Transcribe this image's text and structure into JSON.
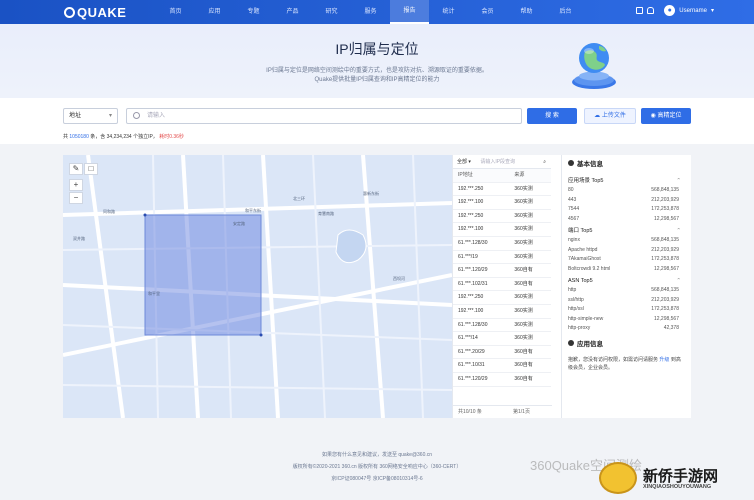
{
  "header": {
    "logo": "QUAKE",
    "nav": [
      "首页",
      "应用",
      "专题",
      "产品",
      "研究",
      "服务",
      "报告",
      "统计",
      "会员",
      "帮助",
      "后台"
    ],
    "active_nav": "报告",
    "username": "Username"
  },
  "hero": {
    "title": "IP归属与定位",
    "line1": "IP归属与定位是网络空间测绘中的重要方式，也是攻防对抗、溯源取证的重要依据。",
    "line2": "Quake提供批量IP归属查询和IP高精定位的能力"
  },
  "search": {
    "select_value": "地址",
    "placeholder": "请输入",
    "search_btn": "搜 索",
    "upload_btn": "上传文件",
    "locate_btn": "高精定位",
    "stats_prefix": "共",
    "stats_count": "1050180",
    "stats_mid": "条，含 34,234,234 个独立IP，",
    "stats_red": "耗时0.36秒"
  },
  "map": {
    "labels": [
      "同和路",
      "北三环",
      "双井路",
      "和平东街",
      "育慧南路",
      "和平里",
      "安定路",
      "惠新东街",
      "西坝河"
    ],
    "zoom_in": "+",
    "zoom_out": "−"
  },
  "table": {
    "filter": "全部",
    "placeholder": "请输入IP段查询",
    "headers": [
      "IP地址",
      "来源"
    ],
    "rows": [
      [
        "192.***.250",
        "360实测"
      ],
      [
        "192.***.100",
        "360实测"
      ],
      [
        "192.***.250",
        "360实测"
      ],
      [
        "192.***.100",
        "360实测"
      ],
      [
        "61.***.128/30",
        "360实测"
      ],
      [
        "61.***/19",
        "360实测"
      ],
      [
        "61.***.120/29",
        "360自有"
      ],
      [
        "61.***.102/31",
        "360自有"
      ],
      [
        "192.***.250",
        "360实测"
      ],
      [
        "192.***.100",
        "360实测"
      ],
      [
        "61.***.128/30",
        "360实测"
      ],
      [
        "61.***/14",
        "360实测"
      ],
      [
        "61.***.20/29",
        "360自有"
      ],
      [
        "61.***.10/31",
        "360自有"
      ],
      [
        "61.***.120/29",
        "360自有"
      ]
    ],
    "footer_total": "共10/10 条",
    "footer_page": "第1/1页"
  },
  "info": {
    "basic_title": "基本信息",
    "groups": [
      {
        "title": "应用场景 Top5",
        "rows": [
          [
            "80",
            "568,848,135"
          ],
          [
            "443",
            "212,203,929"
          ],
          [
            "7544",
            "172,253,878"
          ],
          [
            "4567",
            "12,298,567"
          ]
        ]
      },
      {
        "title": "端口 Top5",
        "rows": [
          [
            "nginx",
            "568,848,135"
          ],
          [
            "Apache httpd",
            "212,203,929"
          ],
          [
            "7AkamaiGhost",
            "172,253,878"
          ],
          [
            "Boltcrowdi 9.2 html",
            "12,298,567"
          ]
        ]
      },
      {
        "title": "ASN Top5",
        "rows": [
          [
            "http",
            "568,848,135"
          ],
          [
            "ssl/http",
            "212,203,929"
          ],
          [
            "http/ssl",
            "172,253,878"
          ],
          [
            "http-simple-new",
            "12,298,567"
          ],
          [
            "http-proxy",
            "42,378"
          ]
        ]
      }
    ],
    "app_title": "应用信息",
    "app_text1": "抱歉，您没有访问权限，如需访问请服务",
    "app_link": "升级",
    "app_text2": "到高级会员，企业会员。"
  },
  "footer": {
    "line1": "如果您有什么意见和建议，发送至 quake@360.cn",
    "line2": "版权所有©2020-2021 360.cn 版权所有 360网络安全响应中心（360-CERT）",
    "line3": "京ICP证080047号 京ICP备08010314号-6"
  },
  "watermark": "360Quake空间测绘",
  "badge": {
    "name": "新侨手游网",
    "sub": "XINQIAOSHOUYOUWANG"
  }
}
